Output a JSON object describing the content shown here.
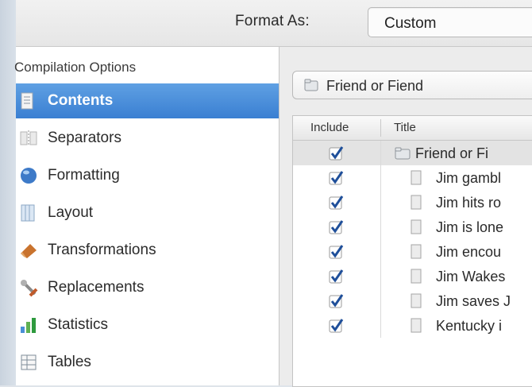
{
  "format_bar": {
    "label": "Format As:",
    "selected": "Custom"
  },
  "sidebar": {
    "header": "Compilation Options",
    "items": [
      {
        "label": "Contents",
        "icon": "contents-icon",
        "selected": true
      },
      {
        "label": "Separators",
        "icon": "separators-icon",
        "selected": false
      },
      {
        "label": "Formatting",
        "icon": "formatting-icon",
        "selected": false
      },
      {
        "label": "Layout",
        "icon": "layout-icon",
        "selected": false
      },
      {
        "label": "Transformations",
        "icon": "transformations-icon",
        "selected": false
      },
      {
        "label": "Replacements",
        "icon": "replacements-icon",
        "selected": false
      },
      {
        "label": "Statistics",
        "icon": "statistics-icon",
        "selected": false
      },
      {
        "label": "Tables",
        "icon": "tables-icon",
        "selected": false
      }
    ]
  },
  "main": {
    "document_selector": "Friend or Fiend",
    "table": {
      "columns": [
        "Include",
        "Title"
      ],
      "rows": [
        {
          "include": true,
          "title": "Friend or Fi",
          "kind": "folder"
        },
        {
          "include": true,
          "title": "Jim gambl",
          "kind": "document"
        },
        {
          "include": true,
          "title": "Jim hits ro",
          "kind": "document"
        },
        {
          "include": true,
          "title": "Jim is lone",
          "kind": "document"
        },
        {
          "include": true,
          "title": "Jim encou",
          "kind": "document"
        },
        {
          "include": true,
          "title": "Jim Wakes",
          "kind": "document"
        },
        {
          "include": true,
          "title": "Jim saves J",
          "kind": "document"
        },
        {
          "include": true,
          "title": "Kentucky i",
          "kind": "document"
        }
      ]
    }
  },
  "colors": {
    "selection": "#3a7fd2",
    "checkbox_mark": "#1f4f9a"
  }
}
